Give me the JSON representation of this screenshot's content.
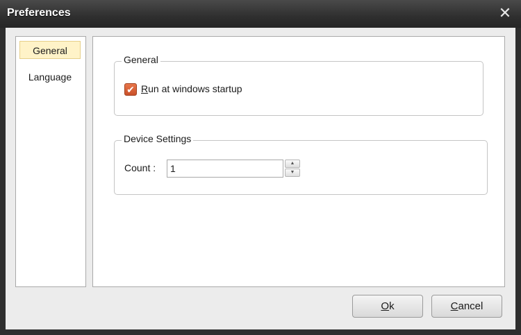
{
  "window": {
    "title": "Preferences",
    "close_icon": "close-icon"
  },
  "nav": {
    "items": [
      {
        "label": "General",
        "selected": true
      },
      {
        "label": "Language",
        "selected": false
      }
    ]
  },
  "general_group": {
    "legend": "General",
    "startup_checkbox": {
      "label_first": "R",
      "label_rest": "un at windows startup",
      "checked": true
    }
  },
  "device_group": {
    "legend": "Device Settings",
    "count_label": "Count :",
    "count_value": "1"
  },
  "buttons": {
    "ok_first": "O",
    "ok_rest": "k",
    "cancel_first": "C",
    "cancel_rest": "ancel"
  },
  "colors": {
    "accent_checkbox": "#d9603a",
    "selected_nav": "#fff3c8"
  }
}
